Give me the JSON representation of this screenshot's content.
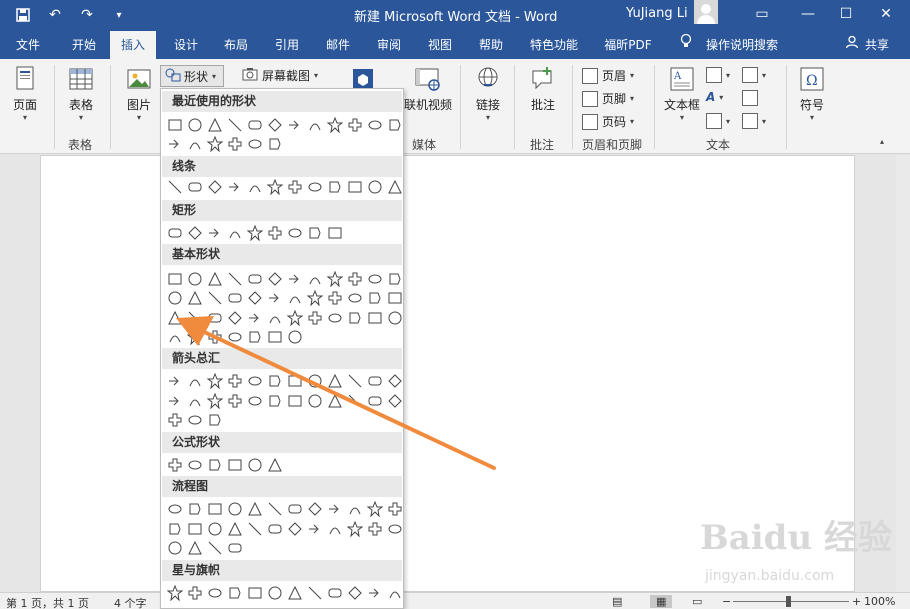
{
  "titlebar": {
    "doc_title": "新建 Microsoft Word 文档 - Word",
    "user_name": "YuJiang Li",
    "minimize": "—",
    "restore": "☐",
    "close": "✕",
    "ribbon_options": "▭"
  },
  "tabs": [
    "文件",
    "开始",
    "插入",
    "设计",
    "布局",
    "引用",
    "邮件",
    "审阅",
    "视图",
    "帮助",
    "特色功能",
    "福昕PDF",
    "操作说明搜索",
    "共享"
  ],
  "ribbon": {
    "page_label": "页面",
    "table_label": "表格",
    "table_group": "表格",
    "picture_label": "图片",
    "shapes_label": "形状",
    "screenshot_label": "屏幕截图",
    "online_video_label": "联机视频",
    "media_group": "媒体",
    "link_label": "链接",
    "comment_label": "批注",
    "comment_group": "批注",
    "header_label": "页眉",
    "footer_label": "页脚",
    "pagenum_label": "页码",
    "header_footer_group": "页眉和页脚",
    "textbox_label": "文本框",
    "text_group": "文本",
    "symbol_label": "符号"
  },
  "dropdown": {
    "sections": [
      "最近使用的形状",
      "线条",
      "矩形",
      "基本形状",
      "箭头总汇",
      "公式形状",
      "流程图",
      "星与旗帜"
    ]
  },
  "statusbar": {
    "pages": "第 1 页，共 1 页",
    "words": "4 个字",
    "zoom": "100%",
    "zoom_minus": "−",
    "zoom_plus": "+"
  },
  "watermark": {
    "main": "Baidu 经验",
    "sub": "jingyan.baidu.com"
  },
  "colors": {
    "brand": "#2b579a",
    "annotation_arrow": "#f08a3c"
  }
}
